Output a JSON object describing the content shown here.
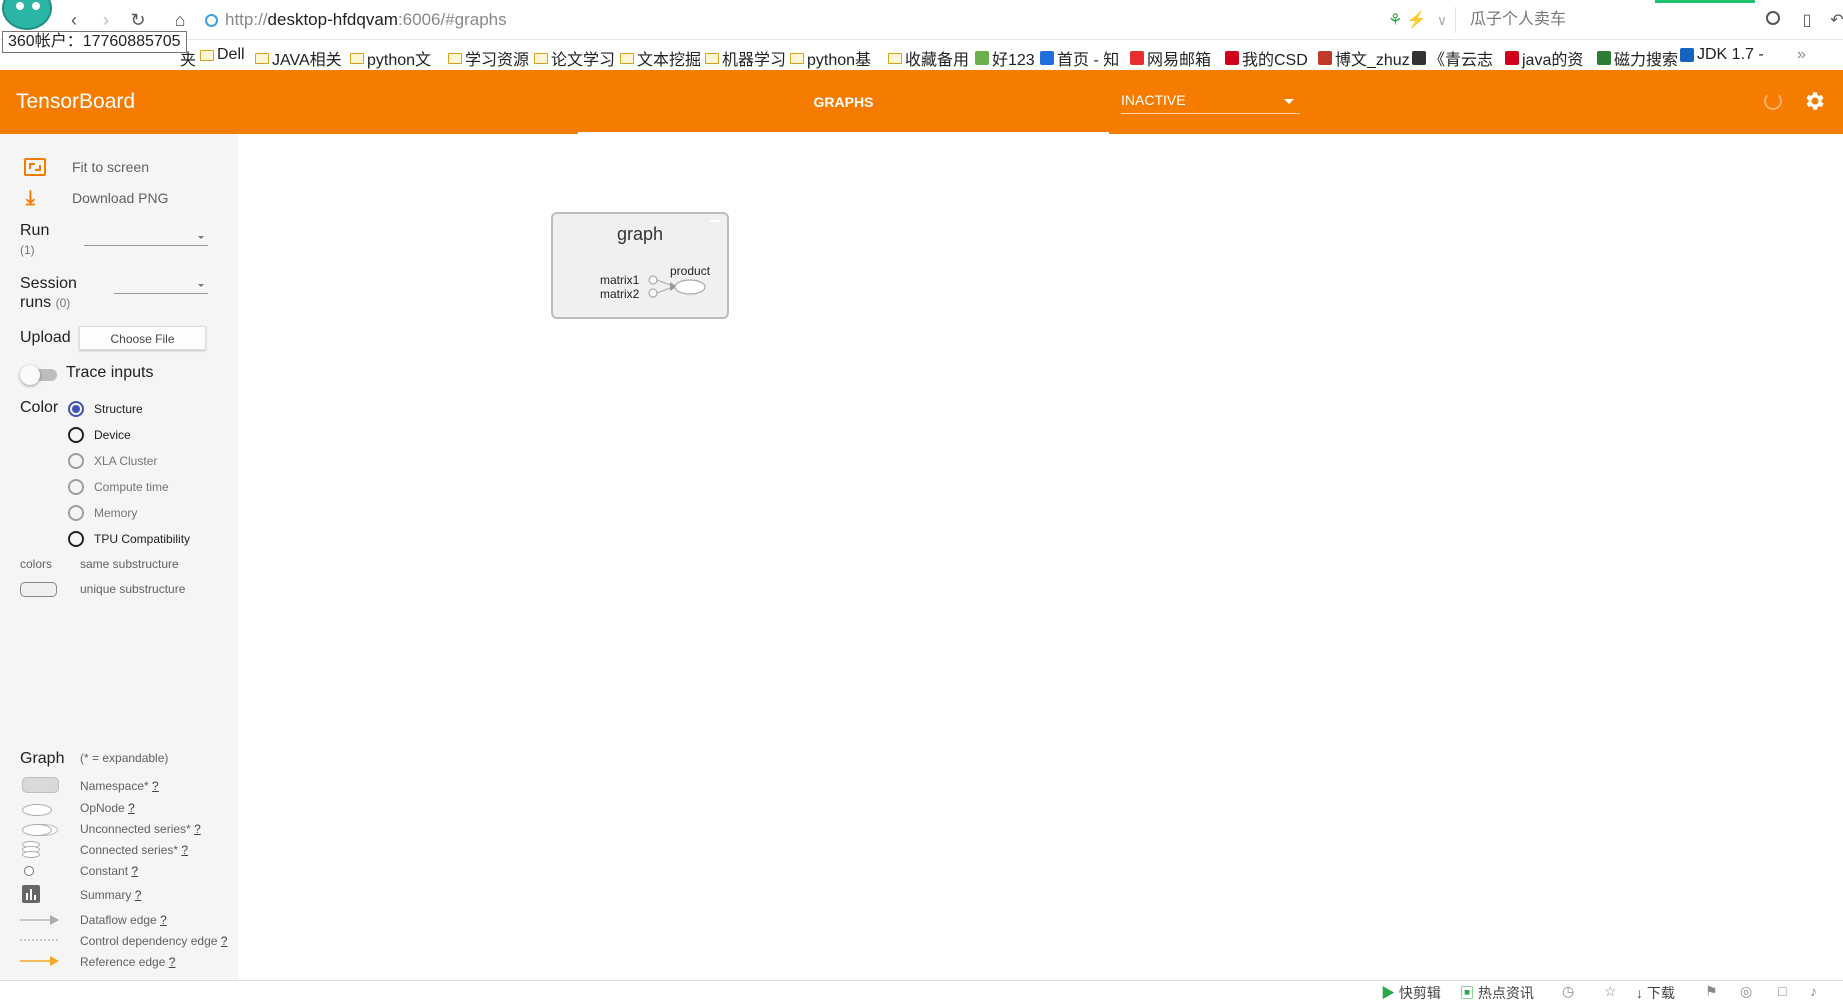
{
  "browser": {
    "tooltip": "360帐户：17760885705",
    "url_scheme": "http://",
    "url_host": "desktop-hfdqvam",
    "url_rest": ":6006/#graphs",
    "search_placeholder": "瓜子个人卖车",
    "bookmarks": [
      "Dell",
      "JAVA相关",
      "python文",
      "学习资源",
      "论文学习",
      "文本挖掘",
      "机器学习",
      "python基",
      "收藏备用",
      "好123",
      "首页 - 知",
      "网易邮箱",
      "我的CSD",
      "博文_zhuz",
      "《青云志",
      "java的资",
      "磁力搜索 -",
      "JDK 1.7 -"
    ],
    "bookmarks_more": "»",
    "bookmark_partial": "夹"
  },
  "header": {
    "title": "TensorBoard",
    "tab": "GRAPHS",
    "run_select": "INACTIVE"
  },
  "sidebar": {
    "fit_to_screen": "Fit to screen",
    "download_png": "Download PNG",
    "run_label": "Run",
    "run_count": "(1)",
    "session_label": "Session",
    "runs_label": "runs",
    "session_count": "(0)",
    "upload_label": "Upload",
    "choose_file": "Choose File",
    "trace_inputs": "Trace inputs",
    "color_label": "Color",
    "color_options": [
      "Structure",
      "Device",
      "XLA Cluster",
      "Compute time",
      "Memory",
      "TPU Compatibility"
    ],
    "colors_label": "colors",
    "same_substructure": "same substructure",
    "unique_substructure": "unique substructure",
    "graph_label": "Graph",
    "expandable_note": "(* = expandable)",
    "legend": [
      "Namespace*",
      "OpNode",
      "Unconnected series*",
      "Connected series*",
      "Constant",
      "Summary",
      "Dataflow edge",
      "Control dependency edge",
      "Reference edge"
    ],
    "help_mark": "?"
  },
  "graph": {
    "title": "graph",
    "inputs": [
      "matrix1",
      "matrix2"
    ],
    "output": "product"
  },
  "statusbar": {
    "items": [
      "快剪辑",
      "热点资讯",
      "下载"
    ]
  },
  "colors": {
    "accent": "#f57c00",
    "radio_checked": "#3f51b5"
  }
}
